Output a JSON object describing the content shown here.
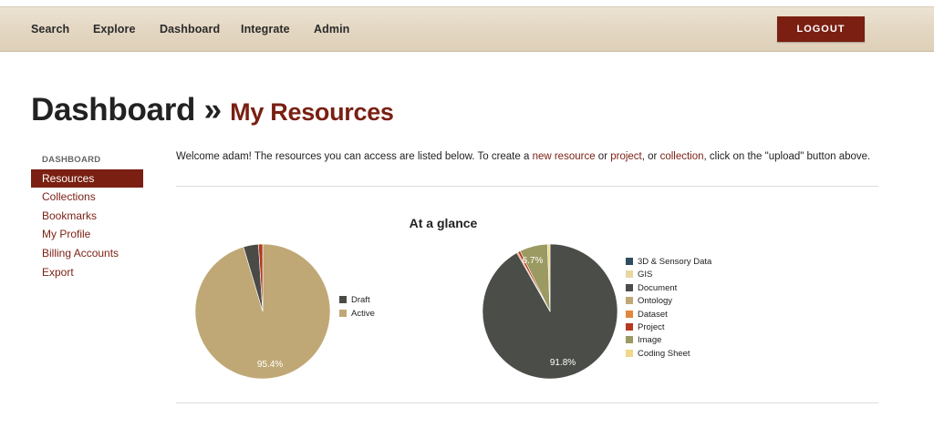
{
  "nav": {
    "items": [
      "Search",
      "Explore",
      "Dashboard",
      "Integrate",
      "Admin"
    ],
    "logout_label": "LOGOUT"
  },
  "header": {
    "title": "Dashboard",
    "separator": "»",
    "subtitle": "My Resources"
  },
  "sidebar": {
    "header": "DASHBOARD",
    "items": [
      {
        "label": "Resources",
        "active": true
      },
      {
        "label": "Collections",
        "active": false
      },
      {
        "label": "Bookmarks",
        "active": false
      },
      {
        "label": "My Profile",
        "active": false
      },
      {
        "label": "Billing Accounts",
        "active": false
      },
      {
        "label": "Export",
        "active": false
      }
    ]
  },
  "welcome": {
    "text_1": "Welcome adam! The resources you can access are listed below. To create a ",
    "link_new_resource": "new resource",
    "text_2": " or ",
    "link_project": "project",
    "text_3": ", or ",
    "link_collection": "collection",
    "text_4": ", click on the \"upload\" button above."
  },
  "glance_title": "At a glance",
  "colors": {
    "brand": "#7a1f12",
    "nav_background": "#e4d8c4"
  },
  "chart_data": [
    {
      "type": "pie",
      "title": "",
      "series": [
        {
          "name": "Draft",
          "value": 3.6,
          "color": "#4a4b47"
        },
        {
          "name": "Active",
          "value": 95.4,
          "color": "#c0a876"
        },
        {
          "name": "",
          "value": 1.0,
          "color": "#b4391e"
        }
      ],
      "slice_labels": [
        "95.4%"
      ],
      "legend": [
        "Draft",
        "Active"
      ],
      "legend_position": "right"
    },
    {
      "type": "pie",
      "title": "",
      "series": [
        {
          "name": "3D & Sensory Data",
          "value": 0.0,
          "color": "#2f4d5c"
        },
        {
          "name": "GIS",
          "value": 0.0,
          "color": "#e8d8a0"
        },
        {
          "name": "Document",
          "value": 91.8,
          "color": "#4a4d48"
        },
        {
          "name": "Ontology",
          "value": 0.0,
          "color": "#c0a876"
        },
        {
          "name": "Dataset",
          "value": 0.3,
          "color": "#e0893a"
        },
        {
          "name": "Project",
          "value": 0.6,
          "color": "#b4391e"
        },
        {
          "name": "Image",
          "value": 6.7,
          "color": "#9a9a62"
        },
        {
          "name": "Coding Sheet",
          "value": 0.6,
          "color": "#f0d888"
        }
      ],
      "slice_labels": [
        "91.8%",
        "6.7%"
      ],
      "legend": [
        "3D & Sensory Data",
        "GIS",
        "Document",
        "Ontology",
        "Dataset",
        "Project",
        "Image",
        "Coding Sheet"
      ],
      "legend_position": "right"
    }
  ]
}
